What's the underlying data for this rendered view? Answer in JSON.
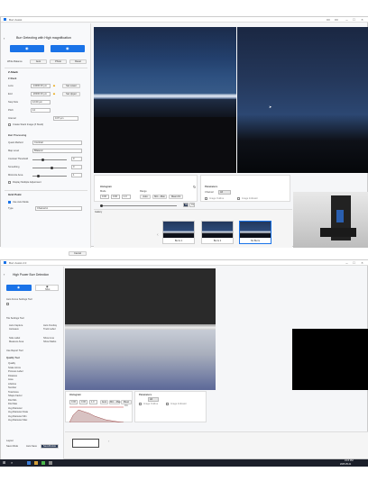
{
  "top": {
    "window_title": "Burr Assist",
    "panel_title": "Burr Detecting with High magnification",
    "labels": {
      "white_balance": "White Balance",
      "auto": "Auto",
      "photo": "Photo",
      "reset": "Reset"
    },
    "z_section": {
      "header": "Z-Stack",
      "subheader": "Z-Stack",
      "rows": [
        {
          "label": "Lens",
          "value": "-14000.00 µm",
          "button": "Set Lower"
        },
        {
          "label": "End",
          "value": "-20000.00 µm",
          "button": "Set Upper"
        },
        {
          "label": "Step Size",
          "value": "12.00 µm"
        },
        {
          "label": "Pitch",
          "value": "14"
        }
      ],
      "interval_label": "Interval",
      "interval_value": "0.07 µm",
      "checkbox_label": "Create Stack Image (Z Stack)"
    },
    "burr_processing": {
      "header": "Burr Processing",
      "rows": [
        {
          "label": "Quant Method",
          "value": "Contrast"
        },
        {
          "label": "Map Level",
          "value": "Bilateral"
        },
        {
          "label": "Contrast Threshold",
          "value": "0"
        },
        {
          "label": "Smoothing",
          "value": "0"
        },
        {
          "label": "Minimize Area",
          "value": "1"
        }
      ],
      "checkbox_label": "Display Multiple Adjustment"
    },
    "sub_section": {
      "header": "Grid Point",
      "auto_label": "Use Auto Mode",
      "type_label": "Type",
      "type_value": "Channel A",
      "cancel": "Cancel"
    },
    "histogram": {
      "title": "Histogram",
      "mode_label": "Mode",
      "range_label": "Range",
      "values": [
        "0.00",
        "0.00",
        "1.0"
      ],
      "buttons": [
        "Auto",
        "Min→Max",
        "Mean Fit"
      ],
      "range_values": [
        "00",
        "01"
      ]
    },
    "parameters": {
      "title": "Parameters",
      "channel_label": "Channel",
      "channel_value": "All",
      "options": [
        "Image Outline",
        "Image Indicator"
      ]
    },
    "gallery": {
      "tab_label": "Gallery",
      "thumbs": [
        "Burrs 1",
        "Burrs 2",
        "No Burrs"
      ]
    }
  },
  "bottom": {
    "window_title": "Burr Assist 2.0",
    "panel_title": "High Power Burr Detection",
    "shot_label": "Shot",
    "panel_sections": [
      "Auto Focus Settings Tool",
      "Tile Settings Tool",
      "Use Report Tool",
      "Quality Tool"
    ],
    "list_rows": [
      "Quality",
      "Scale Arrow",
      "Process Label",
      "Distance",
      "Area",
      "Lifetime",
      "Number",
      "Total Area",
      "Shape Factor",
      "Dist Min",
      "Dist Max",
      "Avg Diameter",
      "Avg Diameter Data",
      "Avg Diameter Min",
      "Avg Diameter Max"
    ],
    "checks": [
      "Auto Capture",
      "Auto Overlay",
      "Autosave",
      "Track Label",
      "Side Label",
      "Show Line",
      "Measure Area",
      "Show Marks"
    ],
    "footer_labels": [
      "Layout",
      "Save Mode",
      "Auto Save"
    ],
    "footer_value": "Save/Delete",
    "histogram": {
      "title": "Histogram",
      "values": [
        "0.00",
        "0.00",
        "1.0"
      ],
      "buttons": [
        "Auto",
        "Min→Max",
        "Mean Fit"
      ]
    },
    "parameters": {
      "title": "Parameters",
      "channel_value": "All",
      "options": [
        "Image Outline",
        "Image Indicator"
      ]
    }
  },
  "taskbar": {
    "clock": "3:15 PM",
    "date": "2025-05-21"
  },
  "colors": {
    "accent": "#1a73e8",
    "panel_bg": "#f5f6f8",
    "viewer_bg": "#0c0c0f"
  }
}
